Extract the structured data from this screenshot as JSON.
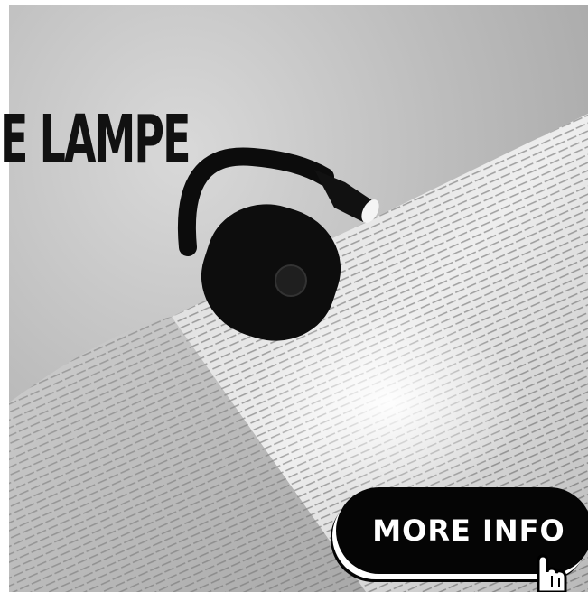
{
  "headline": {
    "text": "E LAMPE"
  },
  "cta": {
    "label": "MORE INFO"
  },
  "icons": {
    "cursor": "hand-pointer-icon"
  },
  "colors": {
    "cta_bg": "#050505",
    "cta_text": "#ffffff",
    "headline": "#111111"
  }
}
